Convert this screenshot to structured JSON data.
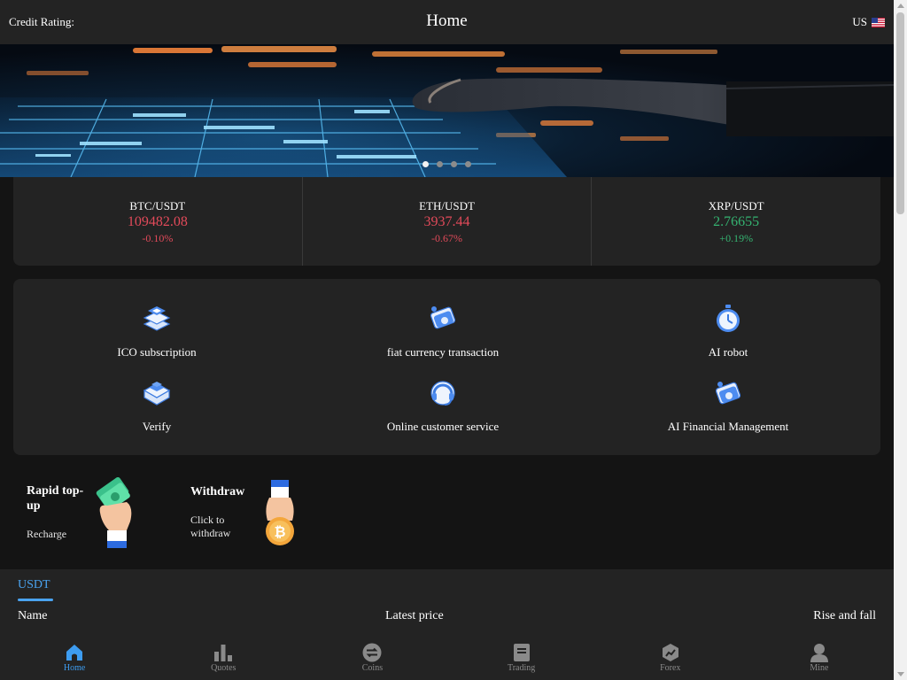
{
  "header": {
    "credit_label": "Credit Rating:",
    "title": "Home",
    "language": "US",
    "flag_icon": "us-flag-icon"
  },
  "banner": {
    "slide_count": 4,
    "active_slide": 1
  },
  "tickers": [
    {
      "pair": "BTC/USDT",
      "price": "109482.08",
      "change": "-0.10%",
      "trend": "down"
    },
    {
      "pair": "ETH/USDT",
      "price": "3937.44",
      "change": "-0.67%",
      "trend": "down"
    },
    {
      "pair": "XRP/USDT",
      "price": "2.76655",
      "change": "+0.19%",
      "trend": "up"
    }
  ],
  "services": [
    {
      "label": "ICO subscription",
      "icon": "ico-stack-icon"
    },
    {
      "label": "fiat currency transaction",
      "icon": "fiat-card-icon"
    },
    {
      "label": "AI robot",
      "icon": "stopwatch-icon"
    },
    {
      "label": "Verify",
      "icon": "verify-stack-icon"
    },
    {
      "label": "Online customer service",
      "icon": "headset-icon"
    },
    {
      "label": "AI Financial Management",
      "icon": "finance-card-icon"
    }
  ],
  "actions": {
    "topup": {
      "title": "Rapid top-up",
      "subtitle": "Recharge",
      "icon": "cash-hand-icon"
    },
    "withdraw": {
      "title": "Withdraw",
      "subtitle": "Click to withdraw",
      "icon": "bitcoin-hand-icon"
    }
  },
  "market": {
    "tab": "USDT",
    "columns": {
      "name": "Name",
      "price": "Latest price",
      "change": "Rise and fall"
    }
  },
  "nav": [
    {
      "label": "Home",
      "icon": "home-icon",
      "active": true
    },
    {
      "label": "Quotes",
      "icon": "bar-chart-icon",
      "active": false
    },
    {
      "label": "Coins",
      "icon": "swap-icon",
      "active": false
    },
    {
      "label": "Trading",
      "icon": "document-icon",
      "active": false
    },
    {
      "label": "Forex",
      "icon": "forex-cube-icon",
      "active": false
    },
    {
      "label": "Mine",
      "icon": "user-icon",
      "active": false
    }
  ],
  "colors": {
    "accent": "#3d9cf0",
    "down": "#e24a5a",
    "up": "#35b371",
    "panel": "#232323",
    "background": "#141414"
  }
}
